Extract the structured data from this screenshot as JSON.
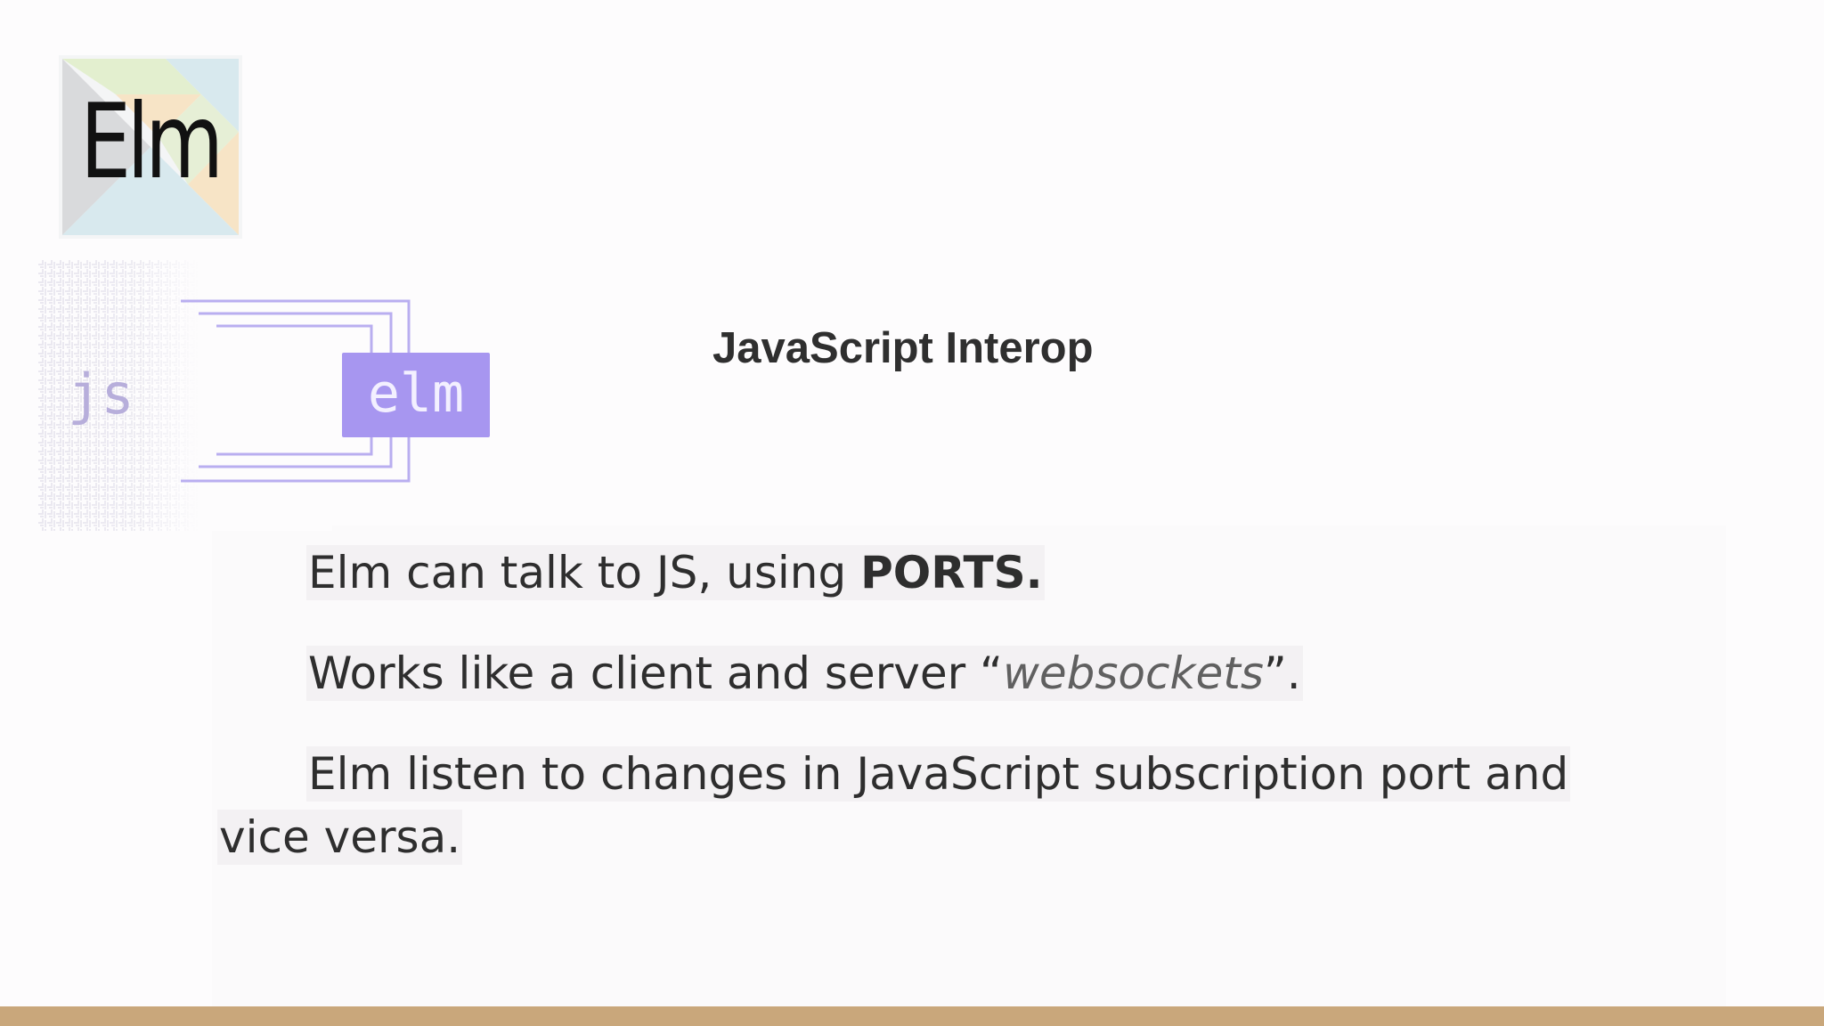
{
  "logo": {
    "text": "Elm",
    "icon": "elm-tangram-icon",
    "colors": {
      "gray": "#d9dadc",
      "green": "#e3efcf",
      "blue": "#d8e9ee",
      "orange": "#f7e4c6"
    }
  },
  "diagram": {
    "left_label": "js",
    "right_label": "elm",
    "box_color": "#a796f0",
    "line_color": "#b9aef0"
  },
  "slide": {
    "title": "JavaScript Interop",
    "lines": [
      {
        "prefix": "Elm can talk to JS, using ",
        "bold": "PORTS."
      },
      {
        "prefix": "Works like a client and server “",
        "italic": "websockets",
        "suffix": "”."
      },
      {
        "text_first": "Elm listen to changes in JavaScript subscription port and",
        "text_second": "vice versa."
      }
    ]
  },
  "footer": {
    "bar_color": "#c9a77b"
  }
}
